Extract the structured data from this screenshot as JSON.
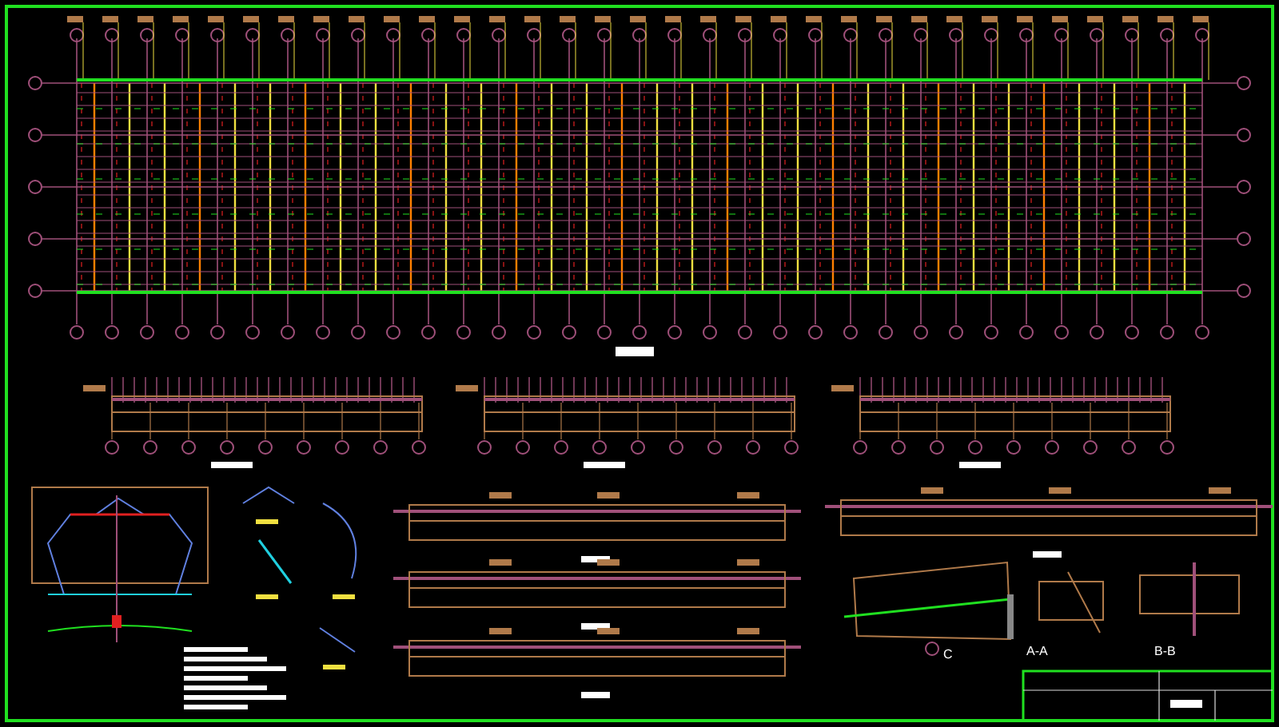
{
  "sheet": {
    "sections": [
      {
        "label": "A-A"
      },
      {
        "label": "B-B"
      }
    ],
    "detail_marker": "C"
  }
}
